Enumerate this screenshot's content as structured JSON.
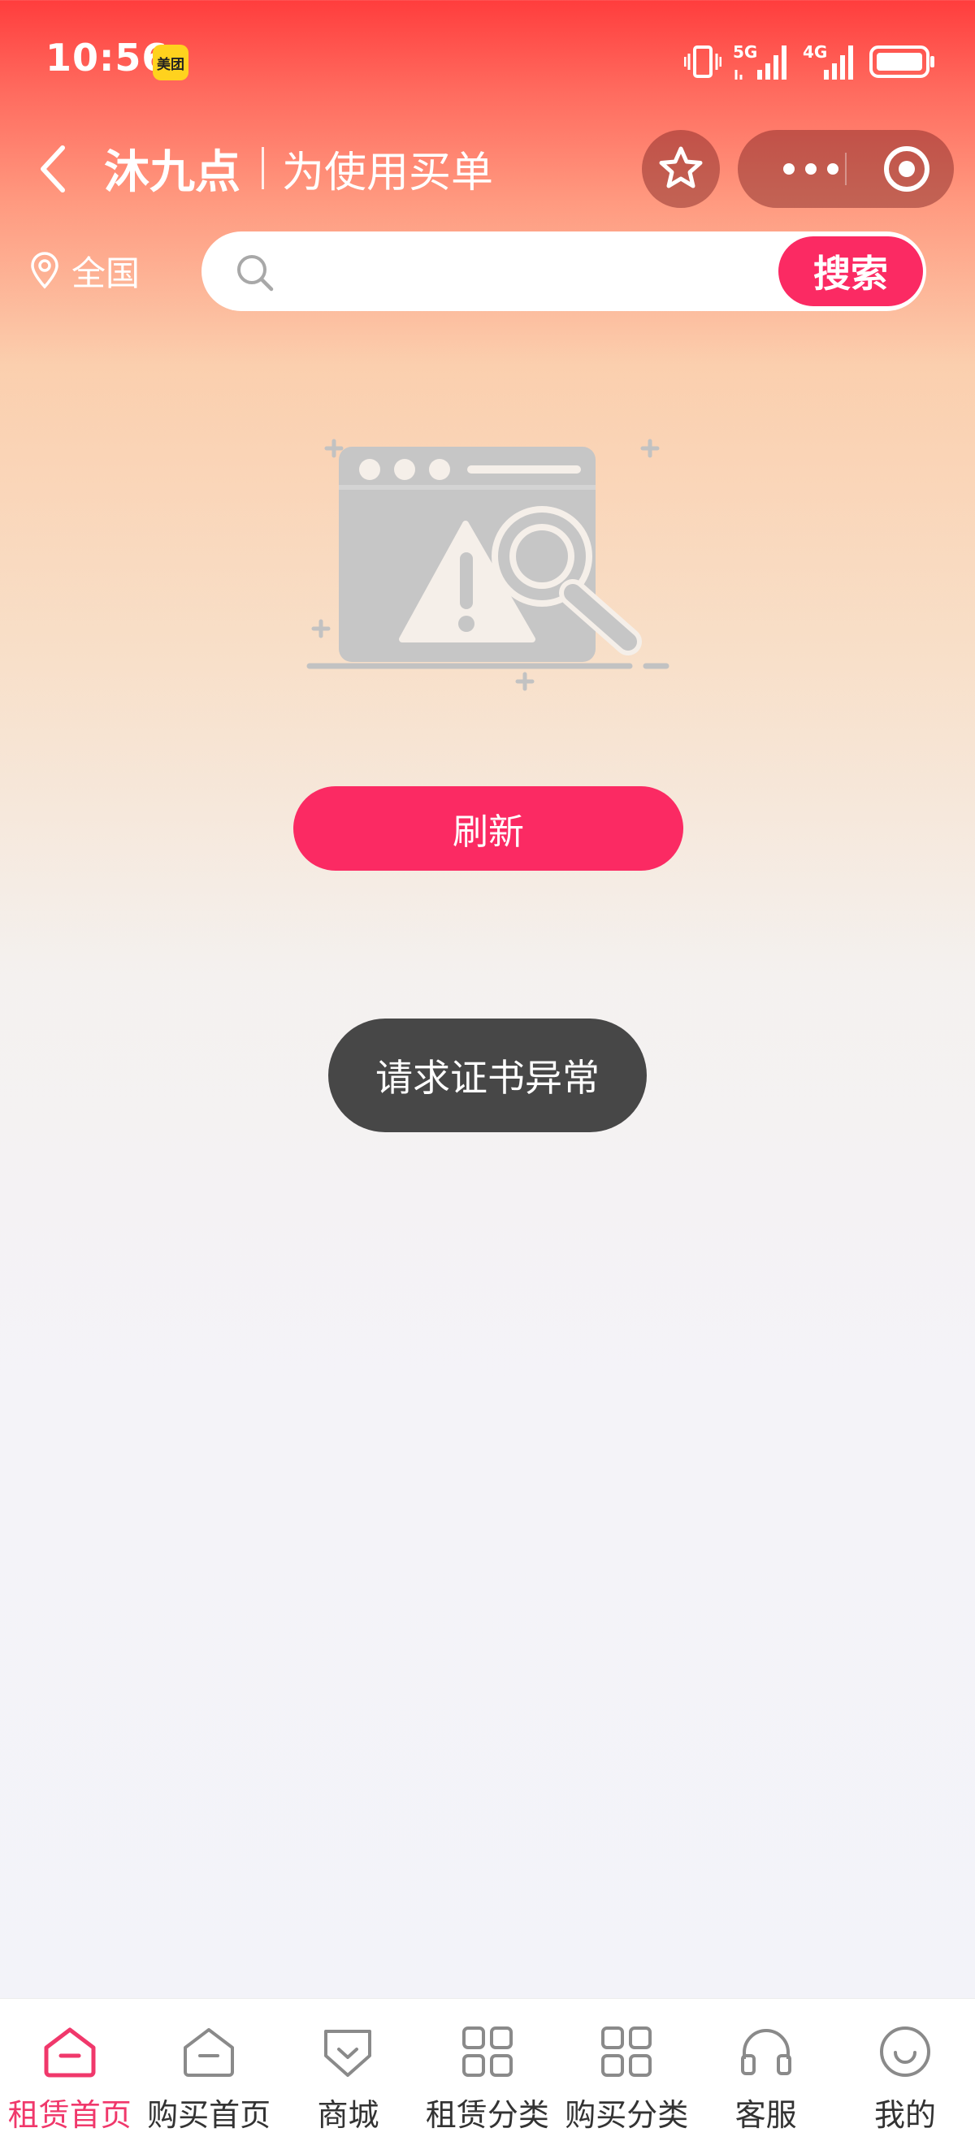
{
  "status_bar": {
    "time": "10:56",
    "app_badge": "美团",
    "network_1": "5G",
    "network_2": "4G"
  },
  "nav": {
    "store_name": "沐九点",
    "subtitle": "为使用买单",
    "icons": [
      "back-arrow-icon",
      "star-icon",
      "more-icon",
      "close-circle-icon"
    ]
  },
  "location": {
    "label": "全国"
  },
  "search": {
    "value": "",
    "placeholder": "",
    "button_label": "搜索"
  },
  "empty_state": {
    "illustration": "browser-warning-search-icon",
    "refresh_label": "刷新"
  },
  "toast": {
    "message": "请求证书异常"
  },
  "tabbar": {
    "active_color": "#f0386b",
    "items": [
      {
        "label": "租赁首页",
        "icon": "home-icon",
        "active": true
      },
      {
        "label": "购买首页",
        "icon": "home-icon",
        "active": false
      },
      {
        "label": "商城",
        "icon": "shop-icon",
        "active": false
      },
      {
        "label": "租赁分类",
        "icon": "grid-icon",
        "active": false
      },
      {
        "label": "购买分类",
        "icon": "grid-icon",
        "active": false
      },
      {
        "label": "客服",
        "icon": "headset-icon",
        "active": false
      },
      {
        "label": "我的",
        "icon": "smile-icon",
        "active": false
      }
    ]
  },
  "colors": {
    "brand_pink": "#fb2a63",
    "header_red": "#ff3d3d"
  }
}
